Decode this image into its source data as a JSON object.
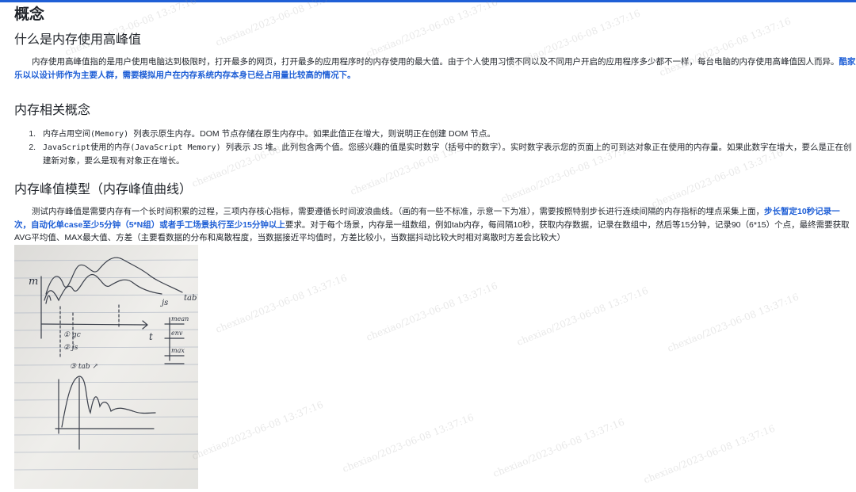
{
  "page": {
    "title": "概念"
  },
  "section1": {
    "heading": "什么是内存使用高峰值",
    "text_a": "内存使用高峰值指的是用户使用电脑达到极限时，打开最多的网页，打开最多的应用程序时的内存使用的最大值。由于个人使用习惯不同以及不同用户开启的应用程序多少都不一样，每台电脑的内存使用高峰值因人而异。",
    "text_b": "酷家乐以以设计师作为主要人群，需要模拟用户在内存系统内存本身已经占用量比较高的情况下。"
  },
  "section2": {
    "heading": "内存相关概念",
    "items": [
      {
        "prefix": "内存占用空间(Memory) ",
        "text": "列表示原生内存。DOM 节点存储在原生内存中。如果此值正在增大，则说明正在创建 DOM 节点。"
      },
      {
        "prefix": "JavaScript使用的内存(JavaScript Memory) ",
        "text": "列表示 JS 堆。此列包含两个值。您感兴趣的值是实时数字（括号中的数字）。实时数字表示您的页面上的可到达对象正在使用的内存量。如果此数字在增大，要么是正在创建新对象，要么是现有对象正在增长。"
      }
    ]
  },
  "section3": {
    "heading": "内存峰值模型（内存峰值曲线）",
    "text_a": "测试内存峰值是需要内存有一个长时间积累的过程，三项内存核心指标，需要遵循长时间波浪曲线。（画的有一些不标准，示意一下为准），需要按照特别步长进行连续间隔的内存指标的埋点采集上面，",
    "text_b": "步长暂定10秒记录一次，自动化单case至少5分钟（5*N组）或者手工场景执行至少15分钟以上",
    "text_c": "要求。对于每个场景，内存是一组数组，例如tab内存，每间隔10秒，获取内存数据，记录在数组中，然后等15分钟，记录90（6*15）个点，最终需要获取AVG平均值、MAX最大值、方差（主要看数据的分布和离散程度，当数据接近平均值时，方差比较小，当数据抖动比较大时相对离散时方差会比较大）"
  },
  "sketch": {
    "label_m": "m",
    "label_tab": "tab",
    "label_js": "js",
    "label_t": "t",
    "note_1": "① gc",
    "note_2": "② js",
    "note_3": "③ tab ↗",
    "legend_mean": "mean",
    "legend_env": "env",
    "legend_max": "max"
  },
  "watermark": {
    "text": "chexiao/2023-06-08 13:37:16"
  },
  "colors": {
    "accent": "#1f5fd6",
    "text": "#1f2329"
  }
}
